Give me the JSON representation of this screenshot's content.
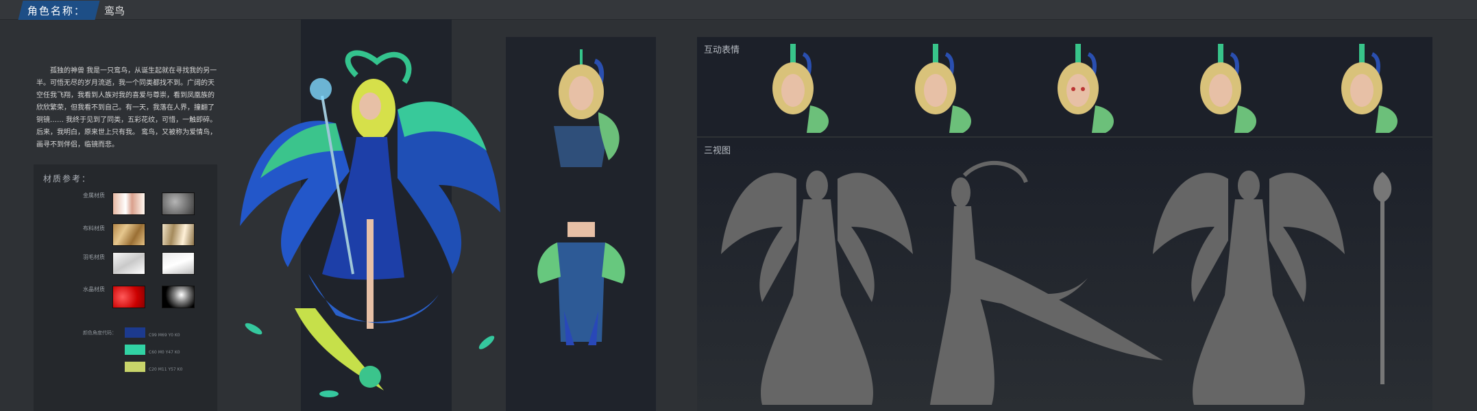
{
  "header": {
    "label": "角色名称：",
    "name": "鸾鸟"
  },
  "story": {
    "text": "孤独的神兽 我是一只鸾鸟，从诞生起就在寻找我的另一半。可悟无尽的岁月流逝，我一个同类都找不到。广阔的天空任我飞翔，我看到人族对我的喜爱与尊崇，看到凤凰族的欣欣繁荣，但我看不到自己。有一天，我落在人界，撞翻了铜镜…… 我终于见到了同类，五彩花纹，可惜，一触即碎。 后来，我明白，原来世上只有我。 鸾鸟，又被称为爱情鸟，画寻不到伴侣，临镜而悲。"
  },
  "materials": {
    "title": "材质参考：",
    "rows": [
      {
        "label": "金属材质"
      },
      {
        "label": "布料材质"
      },
      {
        "label": "羽毛材质"
      },
      {
        "label": "水晶材质"
      }
    ],
    "colors_label": "颜色角度代码：",
    "colors": [
      {
        "hex": "#1c3a8e",
        "code": "C99 M69 Y0 K0"
      },
      {
        "hex": "#31d2a4",
        "code": "C60 M0 Y47 K0"
      },
      {
        "hex": "#c8d46a",
        "code": "C20 M11 Y57 K0"
      }
    ]
  },
  "emotes": {
    "label": "互动表情"
  },
  "views": {
    "label": "三视图"
  },
  "palette": {
    "blue": "#1f4fb5",
    "green": "#39c58a",
    "lime": "#c6e04a",
    "skin": "#e7c0a6",
    "hair": "#d9c27a",
    "silhouette": "#666666"
  }
}
